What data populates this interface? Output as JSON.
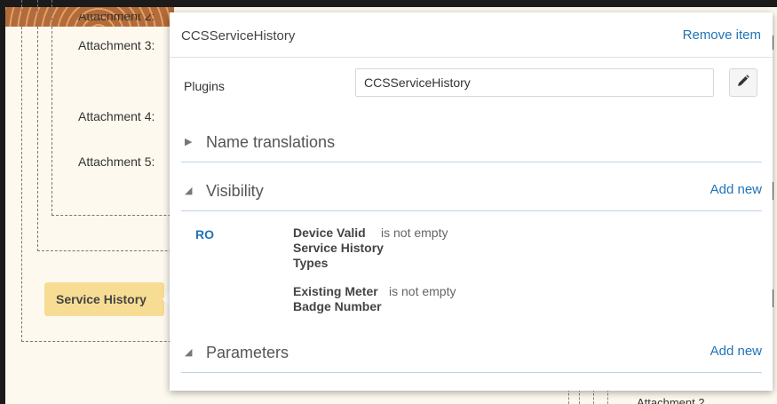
{
  "background": {
    "attachment_labels": [
      "Attachment 2:",
      "Attachment 3:",
      "Attachment 4:",
      "Attachment 5:"
    ],
    "service_tab_label": "Service History",
    "bottom_partial_label": "Attachment 2"
  },
  "panel": {
    "title": "CCSServiceHistory",
    "remove_label": "Remove item",
    "plugins_label": "Plugins",
    "plugins_value": "CCSServiceHistory",
    "edit_icon": "pencil-icon",
    "sections": {
      "name_translations": {
        "title": "Name translations",
        "icon": "triangle-right-icon"
      },
      "visibility": {
        "title": "Visibility",
        "add_label": "Add new",
        "icon": "triangle-down-icon"
      },
      "parameters": {
        "title": "Parameters",
        "add_label": "Add new",
        "icon": "triangle-down-icon"
      }
    },
    "visibility_rule": {
      "mode": "RO",
      "conditions": [
        {
          "field_lines": [
            "Device Valid",
            "Service History",
            "Types"
          ],
          "operator": "is not empty"
        },
        {
          "field_lines": [
            "Existing Meter",
            "Badge Number"
          ],
          "operator": "is not empty"
        }
      ]
    }
  },
  "colors": {
    "link": "#1f73b8",
    "tab_highlight": "#f7dd94",
    "canvas_bg": "#fdf9ef"
  }
}
